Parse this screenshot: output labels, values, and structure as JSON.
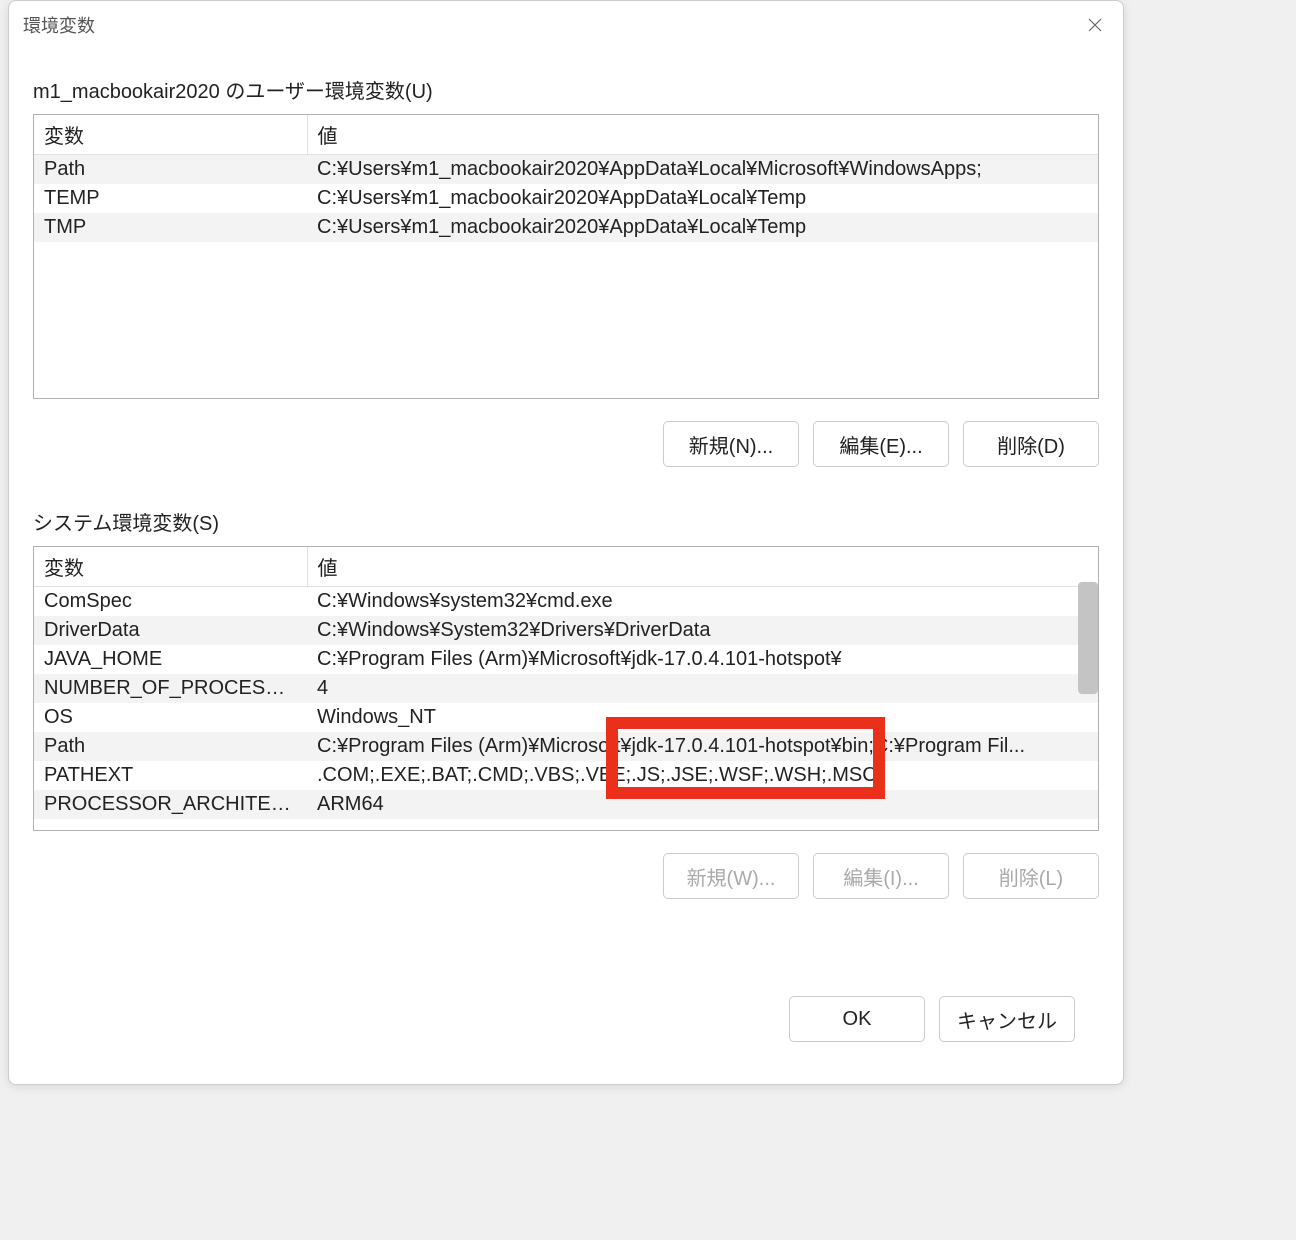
{
  "dialog": {
    "title": "環境変数"
  },
  "user_section": {
    "label": "m1_macbookair2020 のユーザー環境変数(U)",
    "col_var": "変数",
    "col_val": "値",
    "rows": [
      {
        "name": "Path",
        "value": "C:¥Users¥m1_macbookair2020¥AppData¥Local¥Microsoft¥WindowsApps;"
      },
      {
        "name": "TEMP",
        "value": "C:¥Users¥m1_macbookair2020¥AppData¥Local¥Temp"
      },
      {
        "name": "TMP",
        "value": "C:¥Users¥m1_macbookair2020¥AppData¥Local¥Temp"
      }
    ],
    "btn_new": "新規(N)...",
    "btn_edit": "編集(E)...",
    "btn_delete": "削除(D)"
  },
  "system_section": {
    "label": "システム環境変数(S)",
    "col_var": "変数",
    "col_val": "値",
    "rows": [
      {
        "name": "ComSpec",
        "value": "C:¥Windows¥system32¥cmd.exe"
      },
      {
        "name": "DriverData",
        "value": "C:¥Windows¥System32¥Drivers¥DriverData"
      },
      {
        "name": "JAVA_HOME",
        "value": "C:¥Program Files (Arm)¥Microsoft¥jdk-17.0.4.101-hotspot¥"
      },
      {
        "name": "NUMBER_OF_PROCESSORS",
        "value": "4"
      },
      {
        "name": "OS",
        "value": "Windows_NT"
      },
      {
        "name": "Path",
        "value": "C:¥Program Files (Arm)¥Microsoft¥jdk-17.0.4.101-hotspot¥bin;C:¥Program Fil..."
      },
      {
        "name": "PATHEXT",
        "value": ".COM;.EXE;.BAT;.CMD;.VBS;.VBE;.JS;.JSE;.WSF;.WSH;.MSC"
      },
      {
        "name": "PROCESSOR_ARCHITECTURE",
        "value": "ARM64"
      }
    ],
    "btn_new": "新規(W)...",
    "btn_edit": "編集(I)...",
    "btn_delete": "削除(L)"
  },
  "footer": {
    "ok": "OK",
    "cancel": "キャンセル"
  }
}
